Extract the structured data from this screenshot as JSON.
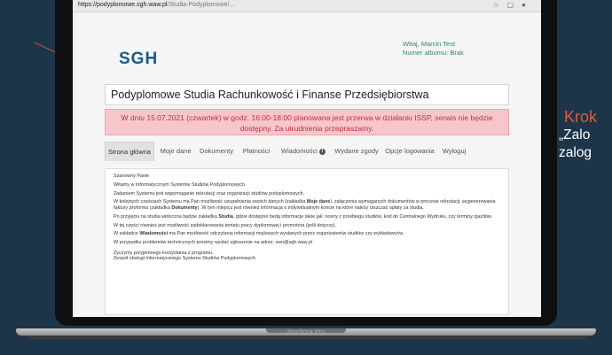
{
  "browser": {
    "url_host": "https://podyplomowe.sgh.waw.pl",
    "url_path": "/Studia-Podyplomowe/..."
  },
  "header": {
    "logo": "SGH",
    "greeting": "Witaj, Marcin Test",
    "album_number": "Numer albumu: Brak"
  },
  "page_title": "Podyplomowe Studia Rachunkowość i Finanse Przedsiębiorstwa",
  "alert": {
    "text": "W dniu 15.07.2021 (czwartek) w godz. 16:00-18:00 planowana jest przerwa w działaniu ISSP, serwis nie będzie dostępny. Za utrudnienia przepraszamy."
  },
  "tabs": [
    {
      "label": "Strona główna",
      "active": true
    },
    {
      "label": "Moje dane"
    },
    {
      "label": "Dokumenty"
    },
    {
      "label": "Płatności"
    },
    {
      "label": "Wiadomości"
    },
    {
      "label": "Wydane zgody"
    },
    {
      "label": "Opcje logowania"
    },
    {
      "label": "Wyloguj"
    }
  ],
  "content": {
    "salutation": "Szanowny Panie",
    "welcome": "Witamy w Informatycznym Systemie Studiów Podyplomowych.",
    "purpose": "Zadaniem Systemu jest wspomaganie rekrutacji oraz organizacji studiów podyplomowych.",
    "p1_a": "W kolejnych częściach Systemu ma Pan możliwość uzupełnienia swoich danych (zakładka ",
    "p1_b1": "Moje dane",
    "p1_c": "), załączenia wymaganych dokumentów w procesie rekrutacji, wygenerowania faktury proforma (zakładka ",
    "p1_b2": "Dokumenty",
    "p1_d": "). W tym miejscu jest również informacja o indywidualnym koncie na które należy uiszczać opłaty za studia.",
    "p2_a": "Po przyjęciu na studia widoczna będzie zakładka ",
    "p2_b": "Studia",
    "p2_c": ", gdzie dostępne będą informacje takie jak: oceny z przebiegu studiów, kod do Centralnego Wydruku, czy terminy zjazdów.",
    "p3": "W tej części również jest możliwość zadeklarowania tematu pracy dyplomowej i promotora (jeśli dotyczy).",
    "p4_a": "W zakładce ",
    "p4_b": "Wiadomości",
    "p4_c": " ma Pan możliwość odczytania informacji mejlowych wysłanych przez organizatorów studiów czy wykładowców.",
    "p5": "W przypadku problemów technicznych prosimy wysłać zgłoszenie na adres: zwn@sgh.waw.pl",
    "closing1": "Życzymy przyjemnego korzystania z programu.",
    "closing2": "Zespół obsługi Informatycznego Systemu Studiów Podyplomowych"
  },
  "device_label": "MacBook Pro",
  "side": {
    "krok": "Krok",
    "line1": "„Zalo",
    "line2": "zalog"
  },
  "colors": {
    "background": "#1d3549",
    "accent": "#e05a3c",
    "logo": "#1a5a8a",
    "user_info": "#2e8b57",
    "alert_bg": "#f7c6cb",
    "alert_text": "#c0313f"
  }
}
